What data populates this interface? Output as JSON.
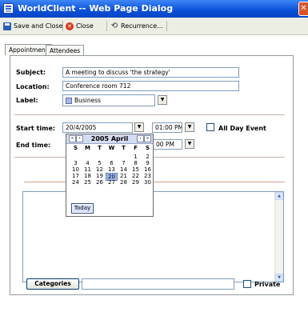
{
  "window": {
    "title": "WorldClient -- Web Page Dialog",
    "close_glyph": "✕"
  },
  "toolbar": {
    "save_close": "Save and Close",
    "close": "Close",
    "recurrence": "Recurrence..."
  },
  "tabs": [
    {
      "label": "Appointment",
      "active": true
    },
    {
      "label": "Attendees",
      "active": false
    }
  ],
  "form": {
    "subject_label": "Subject:",
    "subject_value": "A meeting to discuss 'the strategy'",
    "location_label": "Location:",
    "location_value": "Conference room 712",
    "label_label": "Label:",
    "label_value": "Business",
    "label_color": "#aab8e8",
    "start_label": "Start time:",
    "start_date": "20/4/2005",
    "start_time": "01:00 PM",
    "all_day_label": "All Day Event",
    "end_label": "End time:",
    "end_time": "00 PM",
    "categories_button": "Categories",
    "categories_value": "",
    "private_label": "Private"
  },
  "calendar": {
    "month_label": "2005 April",
    "nav": {
      "prev_year": "«",
      "prev_month": "‹",
      "next_month": "›",
      "next_year": "»"
    },
    "dow": [
      "S",
      "M",
      "T",
      "W",
      "T",
      "F",
      "S"
    ],
    "weeks": [
      [
        "",
        "",
        "",
        "",
        "",
        "1",
        "2"
      ],
      [
        "3",
        "4",
        "5",
        "6",
        "7",
        "8",
        "9"
      ],
      [
        "10",
        "11",
        "12",
        "13",
        "14",
        "15",
        "16"
      ],
      [
        "17",
        "18",
        "19",
        "20",
        "21",
        "22",
        "23"
      ],
      [
        "24",
        "25",
        "26",
        "27",
        "28",
        "29",
        "30"
      ]
    ],
    "selected_day": "20",
    "today_button": "Today"
  }
}
